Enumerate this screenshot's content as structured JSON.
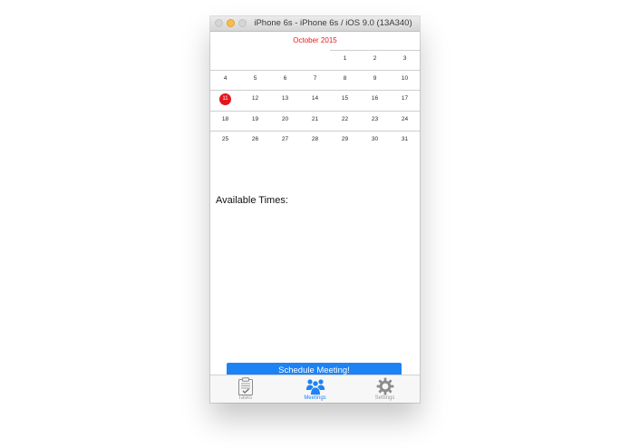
{
  "window": {
    "title": "iPhone 6s - iPhone 6s / iOS 9.0 (13A340)"
  },
  "calendar": {
    "month_title": "October 2015",
    "today": "11",
    "weeks": [
      [
        "",
        "",
        "",
        "",
        "1",
        "2",
        "3"
      ],
      [
        "4",
        "5",
        "6",
        "7",
        "8",
        "9",
        "10"
      ],
      [
        "11",
        "12",
        "13",
        "14",
        "15",
        "16",
        "17"
      ],
      [
        "18",
        "19",
        "20",
        "21",
        "22",
        "23",
        "24"
      ],
      [
        "25",
        "26",
        "27",
        "28",
        "29",
        "30",
        "31"
      ]
    ]
  },
  "main": {
    "available_times_label": "Available Times:",
    "schedule_button_label": "Schedule Meeting!"
  },
  "tabbar": {
    "tabs": [
      {
        "label": "Tasks",
        "icon": "clipboard-icon"
      },
      {
        "label": "Meetings",
        "icon": "people-icon"
      },
      {
        "label": "Settings",
        "icon": "gear-icon"
      }
    ],
    "active_index": 1
  },
  "colors": {
    "accent": "#1d83f5",
    "month_title": "#e31b1b",
    "today_circle": "#e3151d",
    "tab_inactive": "#9a9a9a"
  }
}
